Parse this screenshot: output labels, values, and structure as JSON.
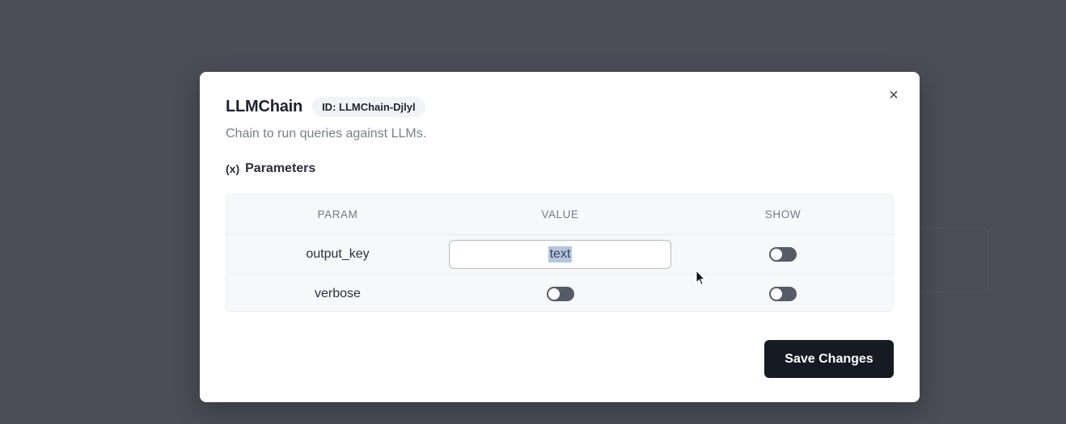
{
  "modal": {
    "title": "LLMChain",
    "id_badge": "ID: LLMChain-Djlyl",
    "description": "Chain to run queries against LLMs.",
    "section_icon": "(x)",
    "section_title": "Parameters",
    "close_icon": "×",
    "save_label": "Save Changes"
  },
  "table": {
    "headers": [
      "PARAM",
      "VALUE",
      "SHOW"
    ],
    "rows": [
      {
        "param": "output_key",
        "value_type": "text-input",
        "value": "text",
        "show": false
      },
      {
        "param": "verbose",
        "value_type": "toggle",
        "value": false,
        "show": false
      }
    ]
  },
  "colors": {
    "overlay": "#4a4d55",
    "primary_button": "#161a23",
    "toggle_off": "#565b68",
    "text_selection": "#b4c6de"
  }
}
